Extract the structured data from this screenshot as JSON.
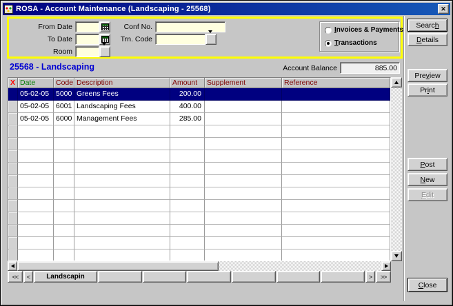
{
  "window": {
    "title": "ROSA - Account Maintenance (Landscaping - 25568)",
    "close_glyph": "✕"
  },
  "colors": {
    "titlebar_left": "#000080",
    "titlebar_right": "#1659b8",
    "panel_border": "#ffff00",
    "field_bg": "#ffffdf",
    "selection_bg": "#000080",
    "selection_text": "#ffffff",
    "account_title": "#0000d2",
    "header_x": "#ff0000",
    "header_date": "#007d00",
    "header_other": "#7d0000",
    "window_bg": "#c6c6c6"
  },
  "filter_panel": {
    "from_date_label": "From Date",
    "from_date_value": "",
    "to_date_label": "To Date",
    "to_date_value": "",
    "room_label": "Room",
    "room_value": "",
    "conf_no_label": "Conf No.",
    "conf_no_value": "",
    "trn_code_label": "Trn. Code",
    "trn_code_value": "",
    "radio_options": [
      {
        "text": "Invoices & Payments",
        "u": 0,
        "selected": false
      },
      {
        "text": "Transactions",
        "u": 0,
        "selected": true
      }
    ]
  },
  "account": {
    "title": "25568 - Landscaping",
    "balance_label": "Account Balance",
    "balance_value": "885.00"
  },
  "table": {
    "columns": [
      {
        "text": "X"
      },
      {
        "text": "Date"
      },
      {
        "text": "Code"
      },
      {
        "text": "Description"
      },
      {
        "text": "Amount"
      },
      {
        "text": "Supplement"
      },
      {
        "text": "Reference"
      }
    ],
    "rows": [
      {
        "date": "05-02-05",
        "code": "5000",
        "description": "Greens Fees",
        "amount": "200.00",
        "supplement": "",
        "reference": "",
        "selected": true
      },
      {
        "date": "05-02-05",
        "code": "6001",
        "description": "Landscaping Fees",
        "amount": "400.00",
        "supplement": "",
        "reference": "",
        "selected": false
      },
      {
        "date": "05-02-05",
        "code": "6000",
        "description": "Management Fees",
        "amount": "285.00",
        "supplement": "",
        "reference": "",
        "selected": false
      }
    ],
    "empty_row_count": 11
  },
  "side_buttons": {
    "search": {
      "text": "Search",
      "u": 5
    },
    "details": {
      "text": "Details",
      "u": 0
    },
    "preview": {
      "text": "Preview",
      "u": 3
    },
    "print": {
      "text": "Print",
      "u": 2
    },
    "post": {
      "text": "Post",
      "u": 0
    },
    "new": {
      "text": "New",
      "u": 0
    },
    "edit": {
      "text": "Edit",
      "u": 0
    },
    "close": {
      "text": "Close",
      "u": 0
    }
  },
  "tab_bar": {
    "first": "<<",
    "prev": "<",
    "active_tab": "Landscapin",
    "empty_tab_count": 6,
    "next": ">",
    "last": ">>"
  }
}
